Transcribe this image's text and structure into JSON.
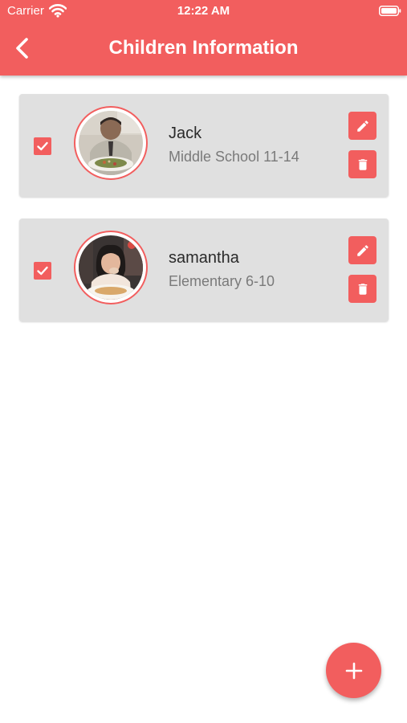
{
  "status_bar": {
    "carrier": "Carrier",
    "time": "12:22 AM",
    "icons": [
      "wifi-icon",
      "battery-icon"
    ]
  },
  "header": {
    "title": "Children Information",
    "back_icon": "chevron-left-icon"
  },
  "colors": {
    "accent": "#f25e5e",
    "card_background": "#e0e0e0",
    "name_text": "#2a2a2a",
    "level_text": "#7a7a7a"
  },
  "children": [
    {
      "name": "Jack",
      "level": "Middle School 11-14",
      "selected": true,
      "edit_icon": "pencil-icon",
      "delete_icon": "trash-icon"
    },
    {
      "name": "samantha",
      "level": "Elementary 6-10",
      "selected": true,
      "edit_icon": "pencil-icon",
      "delete_icon": "trash-icon"
    }
  ],
  "fab": {
    "icon": "plus-icon"
  }
}
